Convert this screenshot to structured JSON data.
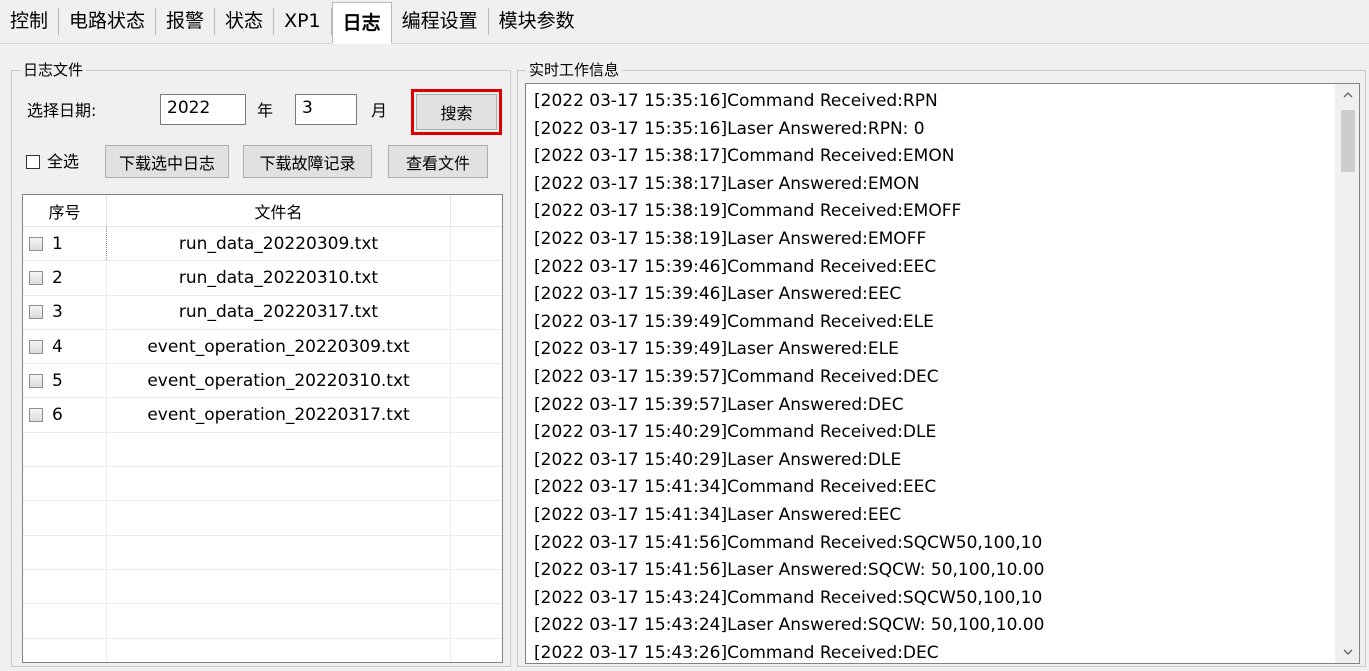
{
  "tabs": [
    {
      "label": "控制",
      "active": false
    },
    {
      "label": "电路状态",
      "active": false
    },
    {
      "label": "报警",
      "active": false
    },
    {
      "label": "状态",
      "active": false
    },
    {
      "label": "XP1",
      "active": false
    },
    {
      "label": "日志",
      "active": true
    },
    {
      "label": "编程设置",
      "active": false
    },
    {
      "label": "模块参数",
      "active": false
    }
  ],
  "log_file_group": {
    "title": "日志文件",
    "date_label": "选择日期:",
    "year_value": "2022",
    "year_unit": "年",
    "month_value": "3",
    "month_unit": "月",
    "search_label": "搜索",
    "select_all_label": "全选",
    "download_selected_label": "下载选中日志",
    "download_fault_label": "下载故障记录",
    "view_file_label": "查看文件",
    "columns": [
      "序号",
      "文件名"
    ],
    "files": [
      {
        "index": "1",
        "name": "run_data_20220309.txt"
      },
      {
        "index": "2",
        "name": "run_data_20220310.txt"
      },
      {
        "index": "3",
        "name": "run_data_20220317.txt"
      },
      {
        "index": "4",
        "name": "event_operation_20220309.txt"
      },
      {
        "index": "5",
        "name": "event_operation_20220310.txt"
      },
      {
        "index": "6",
        "name": "event_operation_20220317.txt"
      }
    ]
  },
  "realtime_group": {
    "title": "实时工作信息",
    "lines": [
      "[2022 03-17 15:35:16]Command Received:RPN",
      "[2022 03-17 15:35:16]Laser Answered:RPN: 0",
      "[2022 03-17 15:38:17]Command Received:EMON",
      "[2022 03-17 15:38:17]Laser Answered:EMON",
      "[2022 03-17 15:38:19]Command Received:EMOFF",
      "[2022 03-17 15:38:19]Laser Answered:EMOFF",
      "[2022 03-17 15:39:46]Command Received:EEC",
      "[2022 03-17 15:39:46]Laser Answered:EEC",
      "[2022 03-17 15:39:49]Command Received:ELE",
      "[2022 03-17 15:39:49]Laser Answered:ELE",
      "[2022 03-17 15:39:57]Command Received:DEC",
      "[2022 03-17 15:39:57]Laser Answered:DEC",
      "[2022 03-17 15:40:29]Command Received:DLE",
      "[2022 03-17 15:40:29]Laser Answered:DLE",
      "[2022 03-17 15:41:34]Command Received:EEC",
      "[2022 03-17 15:41:34]Laser Answered:EEC",
      "[2022 03-17 15:41:56]Command Received:SQCW50,100,10",
      "[2022 03-17 15:41:56]Laser Answered:SQCW: 50,100,10.00",
      "[2022 03-17 15:43:24]Command Received:SQCW50,100,10",
      "[2022 03-17 15:43:24]Laser Answered:SQCW: 50,100,10.00",
      "[2022 03-17 15:43:26]Command Received:DEC"
    ]
  },
  "colors": {
    "window_bg": "#f0f0f0",
    "highlight_border": "#e00000"
  },
  "icons": {
    "scroll_up": "chevron-up-icon",
    "scroll_down": "chevron-down-icon"
  }
}
